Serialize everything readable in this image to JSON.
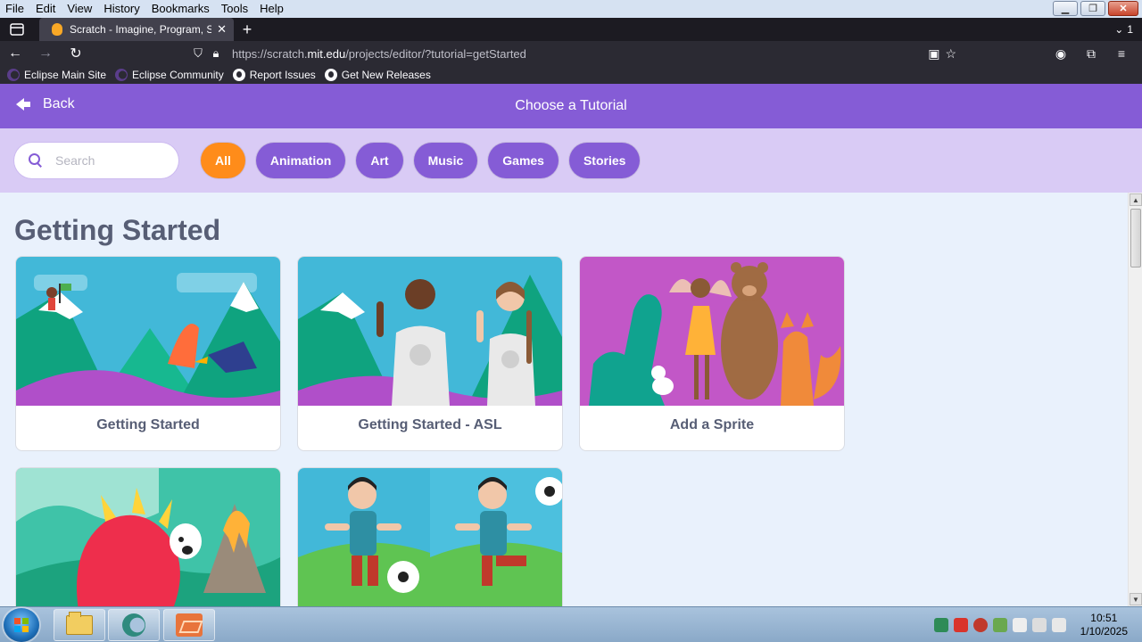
{
  "menubar": {
    "items": [
      "File",
      "Edit",
      "View",
      "History",
      "Bookmarks",
      "Tools",
      "Help"
    ]
  },
  "tab": {
    "title": "Scratch - Imagine, Program, Sha",
    "close": "✕",
    "new_tab": "+",
    "overflow_count": "1"
  },
  "url": {
    "prefix": "https://scratch.",
    "domain": "mit.edu",
    "path": "/projects/editor/?tutorial=getStarted"
  },
  "bookmarks": [
    {
      "label": "Eclipse Main Site",
      "icon": "eclipse-icon"
    },
    {
      "label": "Eclipse Community",
      "icon": "eclipse-icon"
    },
    {
      "label": "Report Issues",
      "icon": "github-icon"
    },
    {
      "label": "Get New Releases",
      "icon": "github-icon"
    }
  ],
  "scratch": {
    "back_label": "Back",
    "title": "Choose a Tutorial",
    "search_placeholder": "Search",
    "filters": [
      "All",
      "Animation",
      "Art",
      "Music",
      "Games",
      "Stories"
    ],
    "active_filter": "All",
    "section_title": "Getting Started",
    "cards": [
      {
        "label": "Getting Started"
      },
      {
        "label": "Getting Started - ASL"
      },
      {
        "label": "Add a Sprite"
      },
      {
        "label": ""
      },
      {
        "label": ""
      }
    ]
  },
  "colors": {
    "scratch_purple": "#855cd6",
    "filter_bg": "#d9cbf5",
    "active_orange": "#ff8c1a",
    "page_bg": "#e9f1fc"
  },
  "taskbar": {
    "time": "10:51",
    "date": "1/10/2025"
  }
}
